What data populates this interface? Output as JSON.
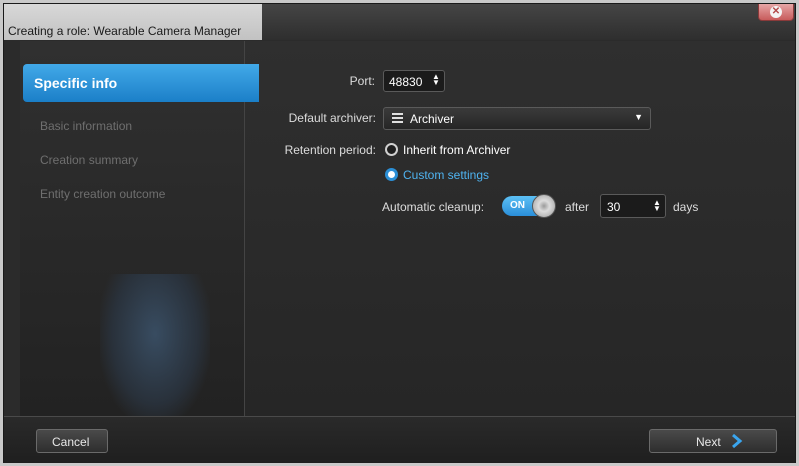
{
  "window": {
    "title": "Creating a role: Wearable Camera Manager"
  },
  "sidebar": {
    "items": [
      {
        "label": "Specific info",
        "active": true
      },
      {
        "label": "Basic information",
        "active": false
      },
      {
        "label": "Creation summary",
        "active": false
      },
      {
        "label": "Entity creation outcome",
        "active": false
      }
    ]
  },
  "form": {
    "port": {
      "label": "Port:",
      "value": "48830"
    },
    "default_archiver": {
      "label": "Default archiver:",
      "value": "Archiver",
      "icon": "archiver-icon"
    },
    "retention": {
      "label": "Retention period:",
      "options": [
        {
          "label": "Inherit from Archiver",
          "selected": false
        },
        {
          "label": "Custom settings",
          "selected": true
        }
      ]
    },
    "automatic_cleanup": {
      "label": "Automatic cleanup:",
      "toggle_text": "ON",
      "enabled": true,
      "after_label": "after",
      "days_value": "30",
      "days_label": "days"
    }
  },
  "footer": {
    "cancel_label": "Cancel",
    "next_label": "Next"
  },
  "colors": {
    "accent": "#2b8fd6",
    "selected_text": "#4fb3f0",
    "background": "#2b2b2b"
  }
}
